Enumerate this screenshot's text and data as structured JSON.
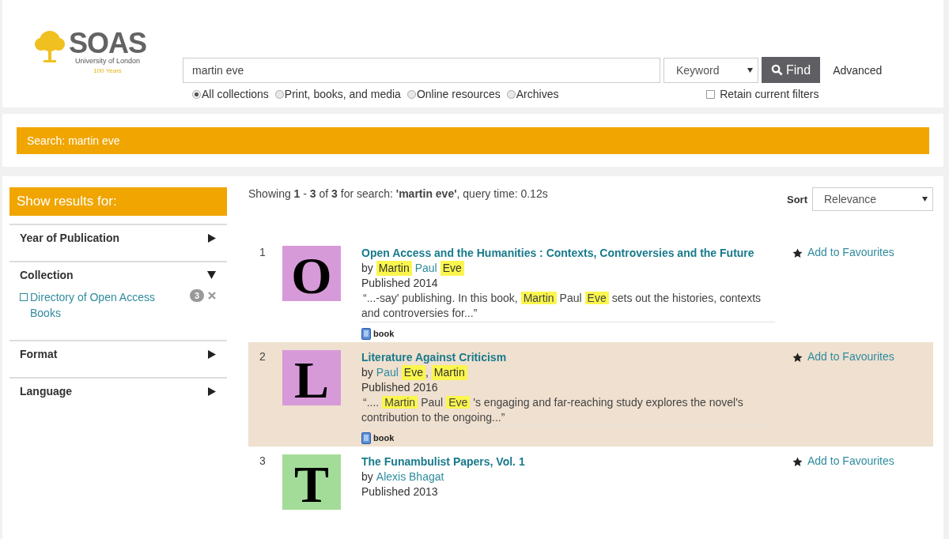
{
  "logo": {
    "name": "SOAS",
    "subtitle": "University of London",
    "anniversary": "100 Years"
  },
  "search": {
    "value": "martin eve",
    "type": "Keyword",
    "find": "Find",
    "advanced": "Advanced",
    "scopes": [
      {
        "label": "All collections",
        "selected": true
      },
      {
        "label": "Print, books, and media",
        "selected": false
      },
      {
        "label": "Online resources",
        "selected": false
      },
      {
        "label": "Archives",
        "selected": false
      }
    ],
    "retain": {
      "label": "Retain current filters",
      "checked": false
    }
  },
  "search_banner": "Search: martin eve",
  "sidebar": {
    "title": "Show results for:",
    "facets": [
      {
        "label": "Year of Publication",
        "expanded": false
      },
      {
        "label": "Collection",
        "expanded": true,
        "items": [
          {
            "label": "Directory of Open Access Books",
            "checked": false,
            "count": "3"
          }
        ]
      },
      {
        "label": "Format",
        "expanded": false
      },
      {
        "label": "Language",
        "expanded": false
      }
    ]
  },
  "summary": "Showing **1** - **3** of **3** for search: **'martin eve'**, query time: 0.12s",
  "sort": {
    "label": "Sort",
    "value": "Relevance"
  },
  "results": [
    {
      "number": "1",
      "letter": "O",
      "color": "#d79ad9",
      "highlighted": false,
      "title": "Open Access and the Humanities : Contexts, Controversies and the Future",
      "by": "by",
      "authors": [
        {
          "kind": "name",
          "text": "Martin",
          "highlight": true
        },
        {
          "kind": "name",
          "text": "Paul",
          "highlight": false
        },
        {
          "kind": "name",
          "text": "Eve",
          "highlight": true
        }
      ],
      "published": "Published 2014",
      "snippet": [
        {
          "text": "“...-say' publishing. In this book,",
          "highlight": false
        },
        {
          "text": "Martin",
          "highlight": true
        },
        {
          "text": "Paul",
          "highlight": false
        },
        {
          "text": "Eve",
          "highlight": true
        },
        {
          "text": "sets out the histories, contexts and controversies for...”",
          "highlight": false
        }
      ],
      "format": "book",
      "favourite": "Add to Favourites"
    },
    {
      "number": "2",
      "letter": "L",
      "color": "#d79ad9",
      "highlighted": true,
      "title": "Literature Against Criticism",
      "by": "by",
      "authors": [
        {
          "kind": "name",
          "text": "Paul",
          "highlight": false
        },
        {
          "kind": "name",
          "text": "Eve",
          "highlight": true
        },
        {
          "kind": "separator",
          "text": ","
        },
        {
          "kind": "name",
          "text": "Martin",
          "highlight": true
        }
      ],
      "published": "Published 2016",
      "snippet": [
        {
          "text": "“....",
          "highlight": false
        },
        {
          "text": "Martin",
          "highlight": true
        },
        {
          "text": "Paul",
          "highlight": false
        },
        {
          "text": "Eve",
          "highlight": true
        },
        {
          "text": "'s engaging and far-reaching study explores the novel's contribution to the ongoing...”",
          "highlight": false
        }
      ],
      "format": "book",
      "favourite": "Add to Favourites"
    },
    {
      "number": "3",
      "letter": "T",
      "color": "#a3dc98",
      "highlighted": false,
      "title": "The Funambulist Papers, Vol. 1",
      "by": "by",
      "authors": [
        {
          "kind": "name",
          "text": "Alexis Bhagat",
          "highlight": false
        }
      ],
      "published": "Published 2013",
      "favourite": "Add to Favourites"
    }
  ]
}
